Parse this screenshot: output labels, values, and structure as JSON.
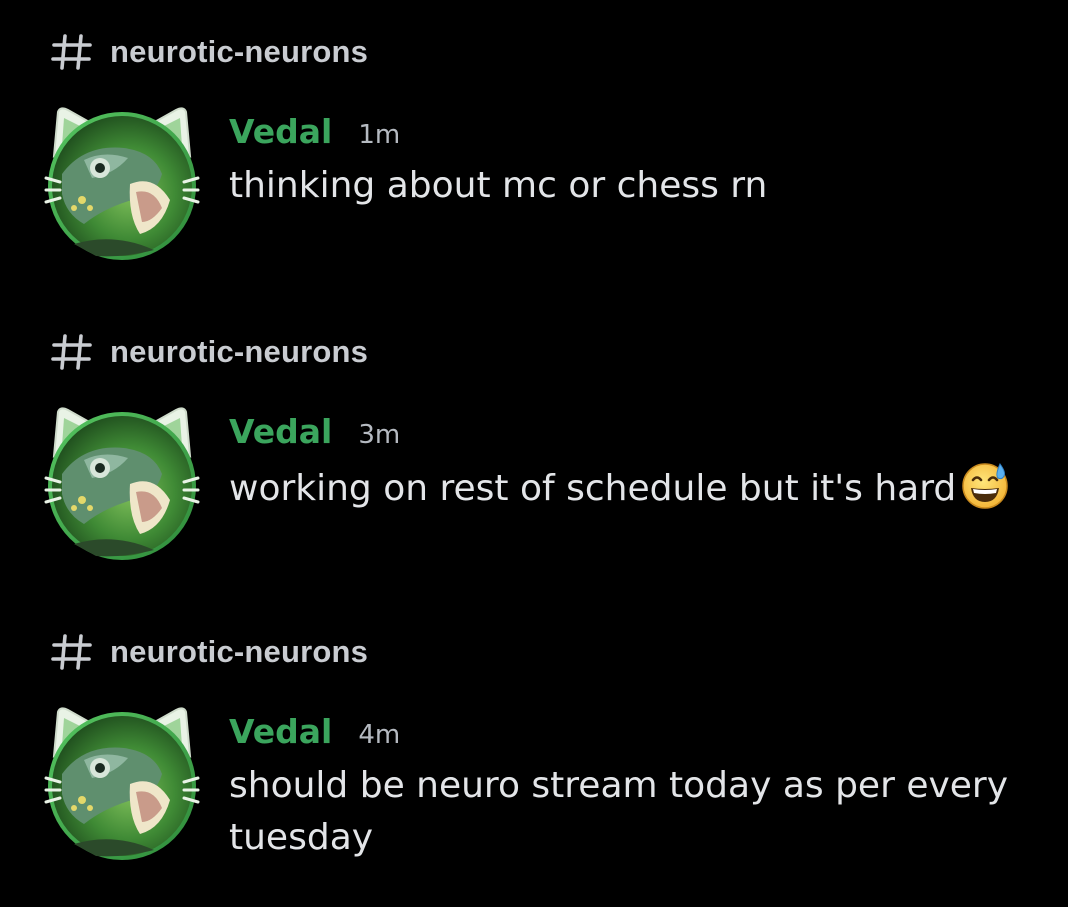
{
  "notifications": [
    {
      "channel": "neurotic-neurons",
      "author": "Vedal",
      "time": "1m",
      "text": "thinking about mc or chess rn",
      "emoji": null
    },
    {
      "channel": "neurotic-neurons",
      "author": "Vedal",
      "time": "3m",
      "text": "working on rest of schedule but it's hard",
      "emoji": "grinning-sweat-emoji"
    },
    {
      "channel": "neurotic-neurons",
      "author": "Vedal",
      "time": "4m",
      "text": "should be neuro stream today as per every tuesday",
      "emoji": null
    }
  ],
  "colors": {
    "background": "#000000",
    "author": "#3ba55d",
    "channel": "#c9ccd1",
    "timestamp": "#b5bac1",
    "message": "#e3e5e8",
    "avatar_ring": "#3fa650"
  },
  "icons": {
    "channel": "hash-icon",
    "avatar": "turtle-cat-ears-avatar"
  }
}
